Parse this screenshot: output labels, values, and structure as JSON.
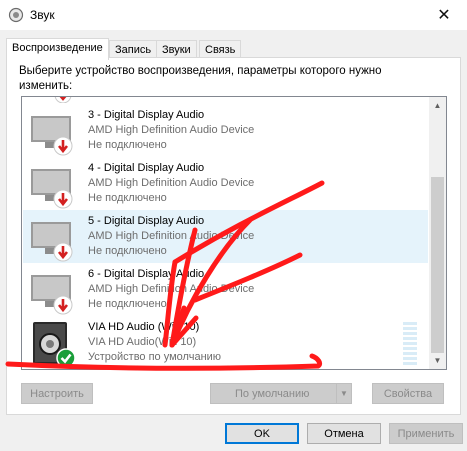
{
  "window": {
    "title": "Звук",
    "close_glyph": "✕"
  },
  "tabs": [
    {
      "label": "Воспроизведение",
      "active": true
    },
    {
      "label": "Запись",
      "active": false
    },
    {
      "label": "Звуки",
      "active": false
    },
    {
      "label": "Связь",
      "active": false
    }
  ],
  "prompt": "Выберите устройство воспроизведения, параметры которого нужно изменить:",
  "devices": [
    {
      "name": "3 - Digital Display Audio",
      "driver": "AMD High Definition Audio Device",
      "status": "Не подключено",
      "icon": "monitor-disconnected-icon"
    },
    {
      "name": "4 - Digital Display Audio",
      "driver": "AMD High Definition Audio Device",
      "status": "Не подключено",
      "icon": "monitor-disconnected-icon"
    },
    {
      "name": "5 - Digital Display Audio",
      "driver": "AMD High Definition Audio Device",
      "status": "Не подключено",
      "icon": "monitor-disconnected-icon",
      "selected": true
    },
    {
      "name": "6 - Digital Display Audio",
      "driver": "AMD High Definition Audio Device",
      "status": "Не подключено",
      "icon": "monitor-disconnected-icon"
    },
    {
      "name": "VIA HD Audio (Win 10)",
      "driver": "VIA HD Audio(Win 10)",
      "status": "Устройство по умолчанию",
      "icon": "speaker-default-icon",
      "default": true
    }
  ],
  "buttons": {
    "configure": "Настроить",
    "set_default": "По умолчанию",
    "properties": "Свойства",
    "ok": "OK",
    "cancel": "Отмена",
    "apply": "Применить"
  },
  "colors": {
    "accent": "#0078d7",
    "annotation_red": "#ff1a1a",
    "default_check": "#1a9e3a",
    "disconnected_badge": "#d32020"
  }
}
